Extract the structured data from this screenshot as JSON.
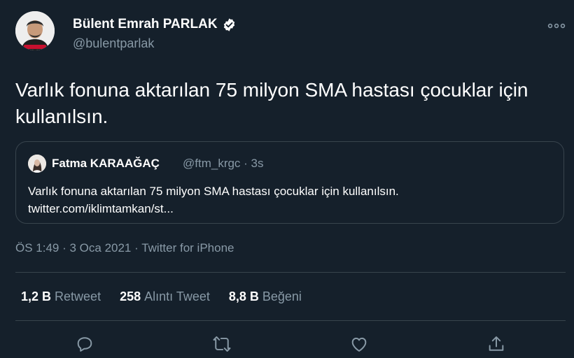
{
  "author": {
    "name": "Bülent Emrah PARLAK",
    "handle": "@bulentparlak",
    "avatar_badge": "Vesikalık",
    "verified_icon": "verified-badge-icon"
  },
  "tweet": {
    "text": "Varlık fonuna aktarılan 75 milyon SMA hastası çocuklar için kullanılsın."
  },
  "quoted_tweet": {
    "name": "Fatma KARAAĞAÇ",
    "meta": "@ftm_krgc · 3s",
    "text": "Varlık fonuna aktarılan 75 milyon SMA hastası çocuklar için kullanılsın.",
    "link": "twitter.com/iklimtamkan/st..."
  },
  "meta": {
    "time": "ÖS 1:49",
    "date": "3 Oca 2021",
    "source": "Twitter for iPhone",
    "separator": " · "
  },
  "stats": [
    {
      "value": "1,2 B",
      "label": "Retweet"
    },
    {
      "value": "258",
      "label": "Alıntı Tweet"
    },
    {
      "value": "8,8 B",
      "label": "Beğeni"
    }
  ],
  "actions": [
    "reply-icon",
    "retweet-icon",
    "like-icon",
    "share-icon"
  ],
  "colors": {
    "background": "#15202b",
    "secondary_text": "#8899a6",
    "border": "#38444d",
    "accent": "#1da1f2"
  }
}
